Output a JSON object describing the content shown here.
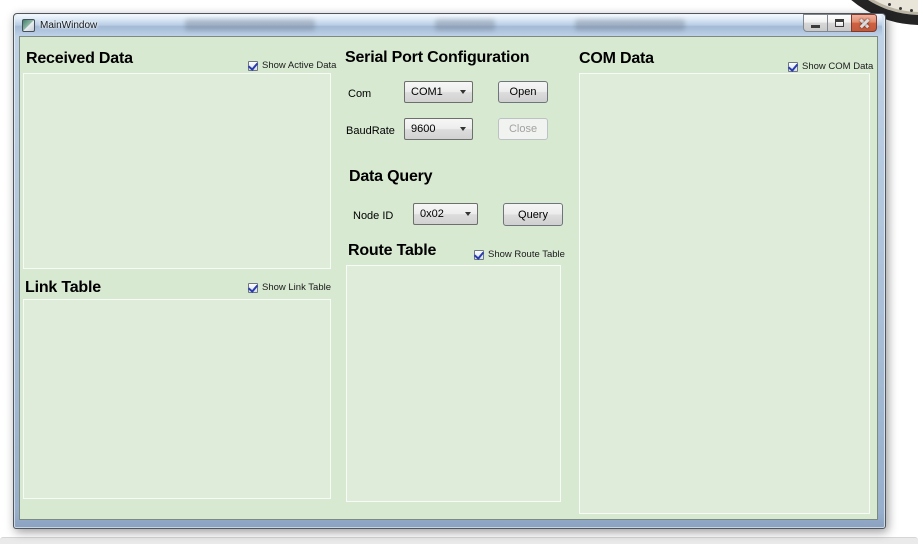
{
  "window": {
    "title": "MainWindow"
  },
  "icons": {
    "app_icon": "application",
    "minimize_icon": "minimize",
    "maximize_icon": "maximize",
    "close_icon": "close",
    "check_icon": "checkmark",
    "dropdown_arrow_icon": "chevron-down",
    "clock_fragment": "wall-clock-partial"
  },
  "sections": {
    "received_data": {
      "title": "Received Data",
      "checkbox_label": "Show Active Data",
      "checkbox_checked": true,
      "content": ""
    },
    "link_table": {
      "title": "Link Table",
      "checkbox_label": "Show Link Table",
      "checkbox_checked": true,
      "content": ""
    },
    "serial_port": {
      "title": "Serial Port Configuration",
      "com_label": "Com",
      "com_value": "COM1",
      "baudrate_label": "BaudRate",
      "baudrate_value": "9600",
      "open_button": "Open",
      "close_button": "Close",
      "close_button_enabled": false
    },
    "data_query": {
      "title": "Data Query",
      "node_id_label": "Node ID",
      "node_id_value": "0x02",
      "query_button": "Query"
    },
    "route_table": {
      "title": "Route Table",
      "checkbox_label": "Show Route Table",
      "checkbox_checked": true,
      "content": ""
    },
    "com_data": {
      "title": "COM Data",
      "checkbox_label": "Show COM Data",
      "checkbox_checked": true,
      "content": ""
    }
  },
  "colors": {
    "content_bg": "#d8e9d2",
    "frame_blue": "#9db3ce",
    "close_button_red": "#cf6242",
    "checkbox_check": "#2b3dae"
  }
}
